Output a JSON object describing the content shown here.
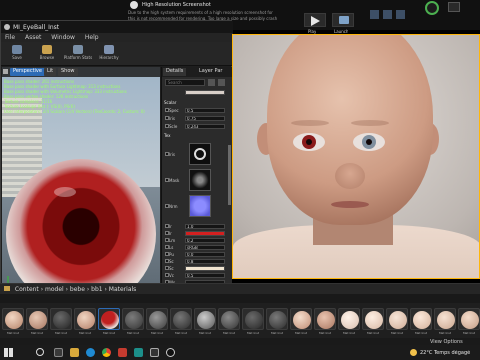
{
  "top": {
    "notice_title": "High Resolution Screenshot",
    "notice_line1": "Due to the high system requirements of a high resolution screenshot for",
    "notice_line2": "this is not recommended for rendering. Too large a size and possibly crash",
    "play_label": "Play",
    "launch_label": "Launch"
  },
  "editor": {
    "title": "MI_EyeBall_Inst",
    "menu": [
      "File",
      "Asset",
      "Window",
      "Help"
    ],
    "toolbar": [
      "Save",
      "Browse",
      "Platform Stats",
      "Hierarchy"
    ]
  },
  "viewport": {
    "tabs": [
      "Perspective",
      "Lit",
      "Show"
    ],
    "stats": [
      "Base pass shader: 261 instructions",
      "Base pass shader with Surface Lightmap: 313 instructions",
      "Base pass shader with Volumetric Lightmap: 333 instructions",
      "Base pass vertex shader: 126 instructions",
      "Texture samplers: 11/16",
      "Texture Lookups (Est.): VS(0), PS(6)",
      "User interpolators: 2/4 Scalars (1/4 Vectors) (TexCoords: 2, Custom: 0)"
    ]
  },
  "details": {
    "tabs": [
      "Details",
      "Layer Par"
    ],
    "search_placeholder": "Search",
    "section_scalar": "Scalar",
    "section_tex": "Tex",
    "rows": [
      {
        "label": "Spec",
        "value": "0.5"
      },
      {
        "label": "Iris",
        "value": "0.75"
      },
      {
        "label": "Scle",
        "value": "0.243"
      }
    ],
    "tex_labels": [
      "Iris",
      "Mask",
      "Nrm"
    ],
    "lower_rows": [
      {
        "label": "Ir",
        "value": "1.0"
      },
      {
        "label": "Ir",
        "value": ""
      },
      {
        "label": "Lm",
        "value": "0.2"
      },
      {
        "label": "Ls",
        "value": "sRGB"
      },
      {
        "label": "Pu",
        "value": "0.0"
      },
      {
        "label": "Sc",
        "value": "0.8"
      },
      {
        "label": "Sc",
        "value": ""
      },
      {
        "label": "Vc",
        "value": "0.5"
      },
      {
        "label": "Ws",
        "value": ""
      }
    ],
    "swatch_colors": [
      "#d32020",
      "#e8e8e8",
      "#d8cfc8",
      "#f0e4d0"
    ]
  },
  "content_browser": {
    "path": [
      "Content",
      "model",
      "bebe",
      "bb1",
      "Materials"
    ],
    "assets": [
      {
        "label": "Mat Inst"
      },
      {
        "label": "Mat Inst"
      },
      {
        "label": "Mat Inst"
      },
      {
        "label": "Mat Inst"
      },
      {
        "label": "Mat Inst"
      },
      {
        "label": "Mat Inst"
      },
      {
        "label": "Mat Inst"
      },
      {
        "label": "Mat Inst"
      },
      {
        "label": "Mat Inst"
      },
      {
        "label": "Mat Inst"
      },
      {
        "label": "Mat Inst"
      },
      {
        "label": "Mat Inst"
      },
      {
        "label": "Mat Inst"
      },
      {
        "label": "Mat Inst"
      },
      {
        "label": "Mat Inst"
      },
      {
        "label": "Mat Inst"
      },
      {
        "label": "Mat Inst"
      },
      {
        "label": "Mat Inst"
      },
      {
        "label": "Mat Inst"
      },
      {
        "label": "Mat Inst"
      }
    ],
    "view_options": "View Options"
  },
  "taskbar": {
    "weather": "22°C Temps dégagé"
  },
  "colors": {
    "accent": "#ffb60a",
    "selection": "#2d6bb5",
    "iris_left": "#8a1b1b",
    "iris_right": "#7f8f9e"
  }
}
